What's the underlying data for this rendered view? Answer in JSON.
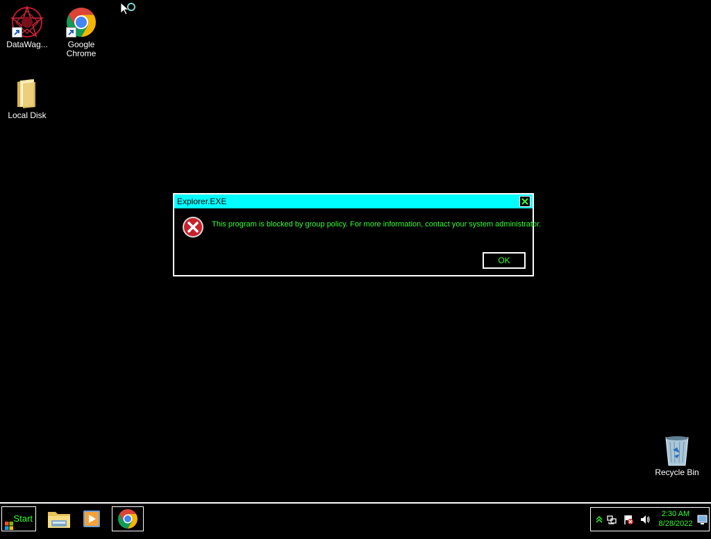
{
  "desktop": {
    "icons": [
      {
        "label": "DataWag...",
        "icon": "datawagon-icon"
      },
      {
        "label": "Google Chrome",
        "icon": "chrome-icon"
      },
      {
        "label": "Local Disk",
        "icon": "folder-icon"
      },
      {
        "label": "Recycle Bin",
        "icon": "recycle-bin-icon"
      }
    ]
  },
  "dialog": {
    "title": "Explorer.EXE",
    "message": "This program is blocked by group policy. For more information, contact your system administrator.",
    "ok_label": "OK",
    "icon": "error-icon"
  },
  "taskbar": {
    "start_label": "Start",
    "pinned": [
      {
        "name": "file-explorer",
        "icon": "file-explorer-icon"
      },
      {
        "name": "media-player",
        "icon": "media-player-icon"
      },
      {
        "name": "chrome",
        "icon": "chrome-icon",
        "active": true
      }
    ],
    "tray": {
      "time": "2:30 AM",
      "date": "8/28/2022"
    }
  },
  "colors": {
    "background": "#000000",
    "titlebar": "#00ffff",
    "text_accent": "#33ff33",
    "border": "#ffffff"
  }
}
